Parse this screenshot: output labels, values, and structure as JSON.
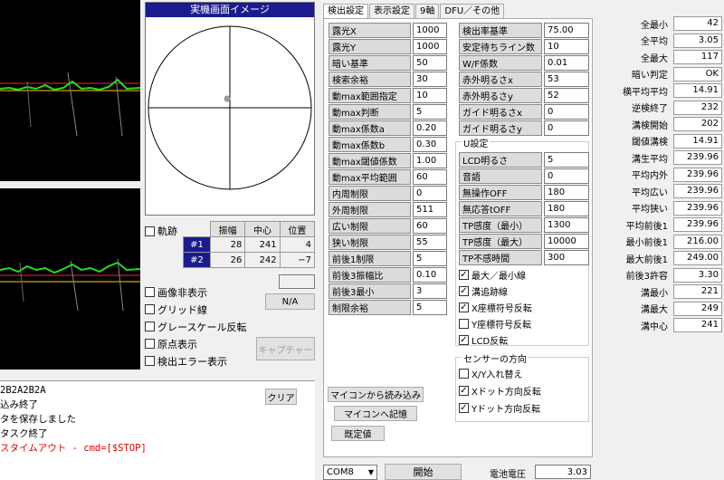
{
  "realtime_panel": {
    "title": "実機画面イメージ"
  },
  "trace": {
    "label": "軌跡",
    "headers": [
      "振幅",
      "中心",
      "位置"
    ],
    "rows": [
      {
        "id": "#1",
        "amp": "28",
        "center": "241",
        "pos": "4"
      },
      {
        "id": "#2",
        "amp": "26",
        "center": "242",
        "pos": "−7"
      }
    ]
  },
  "na_label": "N/A",
  "options": [
    "画像非表示",
    "グリッド線",
    "グレースケール反転",
    "原点表示",
    "検出エラー表示"
  ],
  "capture_btn": "キャプチャー",
  "clear_btn": "クリア",
  "log": [
    {
      "text": "2B2A2B2A",
      "color": "#000000"
    },
    {
      "text": "込み終了",
      "color": "#000000"
    },
    {
      "text": "タを保存しました",
      "color": "#000000"
    },
    {
      "text": "タスク終了",
      "color": "#000000"
    },
    {
      "text": "スタイムアウト - cmd=[$STOP]",
      "color": "#e00000"
    }
  ],
  "tabs": [
    "検出設定",
    "表示設定",
    "9軸",
    "DFU／その他"
  ],
  "params_left": [
    {
      "label": "露光X",
      "value": "1000"
    },
    {
      "label": "露光Y",
      "value": "1000"
    },
    {
      "label": "暗い基準",
      "value": "50"
    },
    {
      "label": "検索余裕",
      "value": "30"
    },
    {
      "label": "動max範囲指定",
      "value": "10"
    },
    {
      "label": "動max判断",
      "value": "5"
    },
    {
      "label": "動max係数a",
      "value": "0.20"
    },
    {
      "label": "動max係数b",
      "value": "0.30"
    },
    {
      "label": "動max閾値係数",
      "value": "1.00"
    },
    {
      "label": "動max平均範囲",
      "value": "60"
    },
    {
      "label": "内周制限",
      "value": "0"
    },
    {
      "label": "外周制限",
      "value": "511"
    },
    {
      "label": "広い制限",
      "value": "60"
    },
    {
      "label": "狭い制限",
      "value": "55"
    },
    {
      "label": "前後1制限",
      "value": "5"
    },
    {
      "label": "前後3振幅比",
      "value": "0.10"
    },
    {
      "label": "前後3最小",
      "value": "3"
    },
    {
      "label": "制限余裕",
      "value": "5"
    }
  ],
  "params_right": [
    {
      "label": "検出率基準",
      "value": "75.00"
    },
    {
      "label": "安定待ちライン数",
      "value": "10"
    },
    {
      "label": "W/F係数",
      "value": "0.01"
    },
    {
      "label": "赤外明るさx",
      "value": "53"
    },
    {
      "label": "赤外明るさy",
      "value": "52"
    },
    {
      "label": "ガイド明るさx",
      "value": "0"
    },
    {
      "label": "ガイド明るさy",
      "value": "0"
    }
  ],
  "u_settings": {
    "title": "U設定",
    "items": [
      {
        "label": "LCD明るさ",
        "value": "5"
      },
      {
        "label": "音語",
        "value": "0"
      },
      {
        "label": "無操作OFF",
        "value": "180"
      },
      {
        "label": "無応答tOFF",
        "value": "180"
      },
      {
        "label": "TP感度（最小）",
        "value": "1300"
      },
      {
        "label": "TP感度（最大）",
        "value": "10000"
      },
      {
        "label": "TP不感時間",
        "value": "300"
      }
    ]
  },
  "u_checks": [
    {
      "label": "最大／最小線",
      "checked": true
    },
    {
      "label": "溝追跡線",
      "checked": true
    },
    {
      "label": "X座標符号反転",
      "checked": true
    },
    {
      "label": "Y座標符号反転",
      "checked": false
    },
    {
      "label": "LCD反転",
      "checked": true
    }
  ],
  "sensor_dir": {
    "title": "センサーの方向",
    "items": [
      {
        "label": "X/Y入れ替え",
        "checked": false
      },
      {
        "label": "Xドット方向反転",
        "checked": true
      },
      {
        "label": "Yドット方向反転",
        "checked": true
      }
    ]
  },
  "buttons": {
    "read": "マイコンから読み込み",
    "write": "マイコンへ記憶",
    "default": "既定値"
  },
  "bottom": {
    "port": "COM8",
    "start": "開始",
    "battery_label": "電池電圧",
    "battery_value": "3.03"
  },
  "stats": [
    {
      "label": "全最小",
      "value": "42"
    },
    {
      "label": "全平均",
      "value": "3.05"
    },
    {
      "label": "全最大",
      "value": "117"
    },
    {
      "label": "暗い判定",
      "value": "OK"
    },
    {
      "label": "横平均平均",
      "value": "14.91"
    },
    {
      "label": "逆検終了",
      "value": "232"
    },
    {
      "label": "溝検開始",
      "value": "202"
    },
    {
      "label": "閾値溝検",
      "value": "14.91"
    },
    {
      "label": "溝生平均",
      "value": "239.96"
    },
    {
      "label": "平均内外",
      "value": "239.96"
    },
    {
      "label": "平均広い",
      "value": "239.96"
    },
    {
      "label": "平均狭い",
      "value": "239.96"
    },
    {
      "label": "平均前後1",
      "value": "239.96"
    },
    {
      "label": "最小前後1",
      "value": "216.00"
    },
    {
      "label": "最大前後1",
      "value": "249.00"
    },
    {
      "label": "前後3許容",
      "value": "3.30"
    },
    {
      "label": "溝最小",
      "value": "221"
    },
    {
      "label": "溝最大",
      "value": "249"
    },
    {
      "label": "溝中心",
      "value": "241"
    }
  ]
}
